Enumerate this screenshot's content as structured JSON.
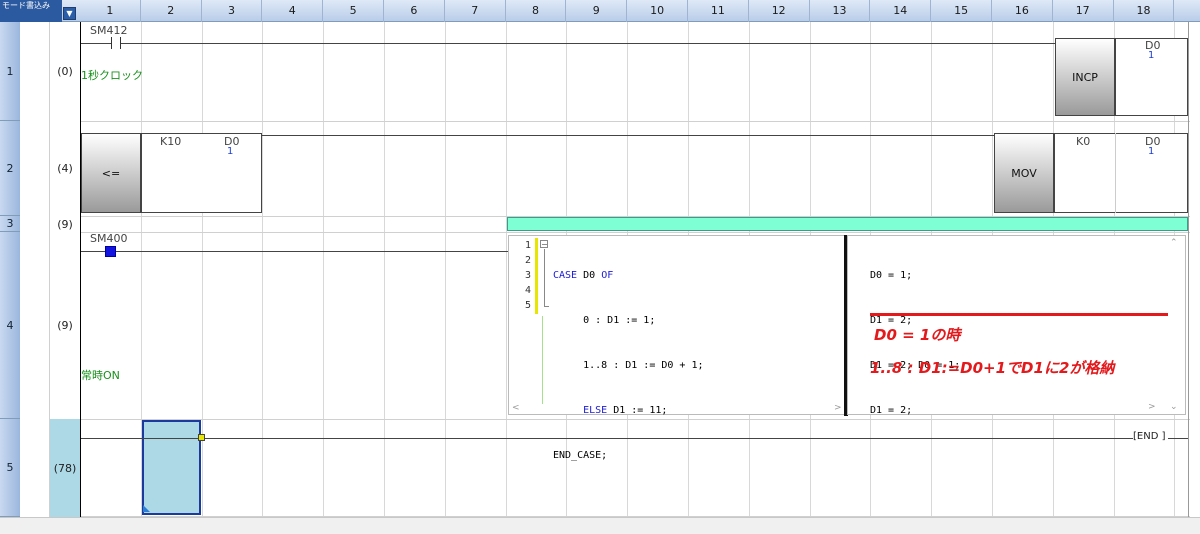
{
  "header": {
    "corner_label": "モード書込み",
    "columns": [
      "1",
      "2",
      "3",
      "4",
      "5",
      "6",
      "7",
      "8",
      "9",
      "10",
      "11",
      "12",
      "13",
      "14",
      "15",
      "16",
      "17",
      "18"
    ]
  },
  "rows": [
    {
      "num": "1",
      "step": "(0)"
    },
    {
      "num": "2",
      "step": "(4)"
    },
    {
      "num": "3",
      "step": "(9)"
    },
    {
      "num": "4",
      "step": "(9)"
    },
    {
      "num": "5",
      "step": "(78)"
    }
  ],
  "rung1": {
    "contact_device": "SM412",
    "comment": "1秒クロック",
    "instruction": "INCP",
    "operand_device": "D0",
    "operand_value": "1"
  },
  "rung2": {
    "compare_op": "<=",
    "compare_s1": "K10",
    "compare_s2_device": "D0",
    "compare_s2_value": "1",
    "instruction": "MOV",
    "mov_src": "K0",
    "mov_dst_device": "D0",
    "mov_dst_value": "1"
  },
  "rung4": {
    "contact_device": "SM400",
    "comment": "常時ON"
  },
  "st_editor": {
    "line_numbers": [
      "1",
      "2",
      "3",
      "4",
      "5"
    ],
    "code_lines": [
      {
        "kw": "CASE",
        "text": " D0 ",
        "kw2": "OF"
      },
      {
        "kw": "",
        "text": "     0 : D1 := 1;",
        "kw2": ""
      },
      {
        "kw": "",
        "text": "     1..8 : D1 := D0 + 1;",
        "kw2": ""
      },
      {
        "kw": "",
        "text": "     ",
        "kw2": "ELSE",
        "tail": " D1 := 11;"
      },
      {
        "kw": "",
        "text": "END_CASE;",
        "kw2": ""
      }
    ],
    "monitor_lines": [
      "D0 = 1;",
      "D1 = 2;",
      "D1 = 2; D0 = 1;",
      "D1 = 2;"
    ]
  },
  "annotation": {
    "line1": "D0 = 1の時",
    "line2": "1..8 : D1:=D0+1でD1に2が格納"
  },
  "end_instruction": "END",
  "colors": {
    "accent_blue": "#2c5aa0",
    "annotation_red": "#e3191c",
    "comment_green": "#17911b",
    "value_blue": "#1f3fd6",
    "cursor_fill": "#add8e6",
    "st_header": "#7fffd4"
  }
}
